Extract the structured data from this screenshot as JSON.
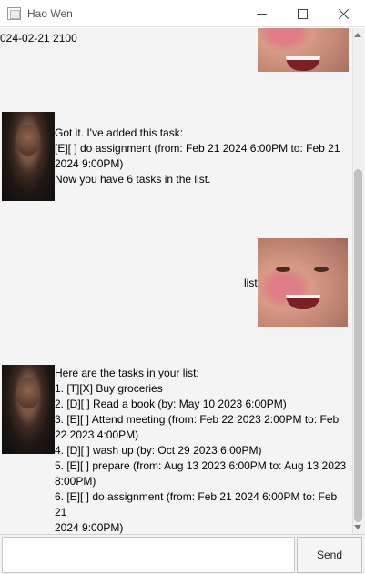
{
  "window": {
    "title": "Hao Wen",
    "controls": [
      "minimize",
      "maximize",
      "close"
    ]
  },
  "chat": {
    "partial_message": "024-02-21 2100",
    "messages": [
      {
        "sender": "duke",
        "lines": [
          "Got it. I've added this task:",
          "[E][ ] do assignment (from: Feb 21 2024 6:00PM to: Feb 21",
          "2024 9:00PM)",
          "Now you have 6 tasks in the list."
        ]
      },
      {
        "sender": "user",
        "text": "list"
      },
      {
        "sender": "duke",
        "lines": [
          "Here are the tasks in your list:",
          "1. [T][X] Buy groceries",
          "2. [D][ ] Read a book (by: May 10 2023 6:00PM)",
          "3. [E][ ] Attend meeting (from: Feb 22 2023 2:00PM to: Feb",
          "22 2023 4:00PM)",
          "4. [D][ ] wash up (by: Oct 29 2023 6:00PM)",
          "5. [E][ ] prepare (from: Aug 13 2023 6:00PM to: Aug 13 2023",
          "8:00PM)",
          "6. [E][ ] do assignment (from: Feb 21 2024 6:00PM to: Feb 21",
          "2024 9:00PM)"
        ]
      }
    ]
  },
  "input": {
    "value": "",
    "placeholder": ""
  },
  "send_button": {
    "label": "Send"
  },
  "icons": {
    "app": "window-icon",
    "duke_avatar": "duke-avatar",
    "user_avatar": "user-avatar"
  },
  "colors": {
    "chat_background": "#f4f4f4",
    "window_background": "#ffffff"
  }
}
